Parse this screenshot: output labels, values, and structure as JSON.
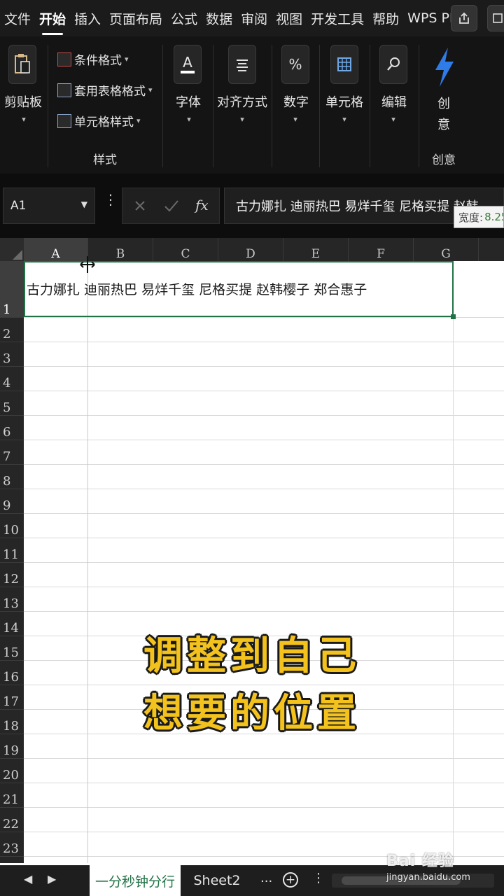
{
  "menubar": {
    "items": [
      "文件",
      "开始",
      "插入",
      "页面布局",
      "公式",
      "数据",
      "审阅",
      "视图",
      "开发工具",
      "帮助",
      "WPS PD"
    ],
    "active_index": 1
  },
  "ribbon": {
    "clipboard": {
      "label": "剪贴板"
    },
    "styles": {
      "items": [
        "条件格式",
        "套用表格格式",
        "单元格样式"
      ],
      "caption": "样式"
    },
    "font": {
      "label": "字体"
    },
    "align": {
      "label": "对齐方式"
    },
    "number": {
      "label": "数字"
    },
    "cells": {
      "label": "单元格"
    },
    "edit": {
      "label": "编辑"
    },
    "creative": {
      "label_1": "创",
      "label_2": "意",
      "caption": "创意"
    }
  },
  "formula_bar": {
    "name_box": "A1",
    "formula": "古力娜扎 迪丽热巴 易烊千玺 尼格买提 赵韩",
    "width_tip_label": "宽度:",
    "width_tip_value": "8.25"
  },
  "sheet": {
    "columns": [
      "A",
      "B",
      "C",
      "D",
      "E",
      "F",
      "G"
    ],
    "selected_column": "A",
    "rows": [
      "1",
      "2",
      "3",
      "4",
      "5",
      "6",
      "7",
      "8",
      "9",
      "10",
      "11",
      "12",
      "13",
      "14",
      "15",
      "16",
      "17",
      "18",
      "19",
      "20",
      "21",
      "22",
      "23"
    ],
    "cell_a1": "古力娜扎 迪丽热巴 易烊千玺 尼格买提 赵韩樱子 郑合惠子"
  },
  "caption": {
    "line1": "调整到自己",
    "line2": "想要的位置"
  },
  "tabs": {
    "active": "一分秒钟分行",
    "second": "Sheet2",
    "more": "...",
    "add": "+",
    "menu": "⋮"
  },
  "watermark": {
    "main": "Bai 经验",
    "sub": "jingyan.baidu.com"
  },
  "colors": {
    "accent_green": "#217346",
    "caption_yellow": "#f3c21c",
    "dark_bg": "#141414"
  }
}
